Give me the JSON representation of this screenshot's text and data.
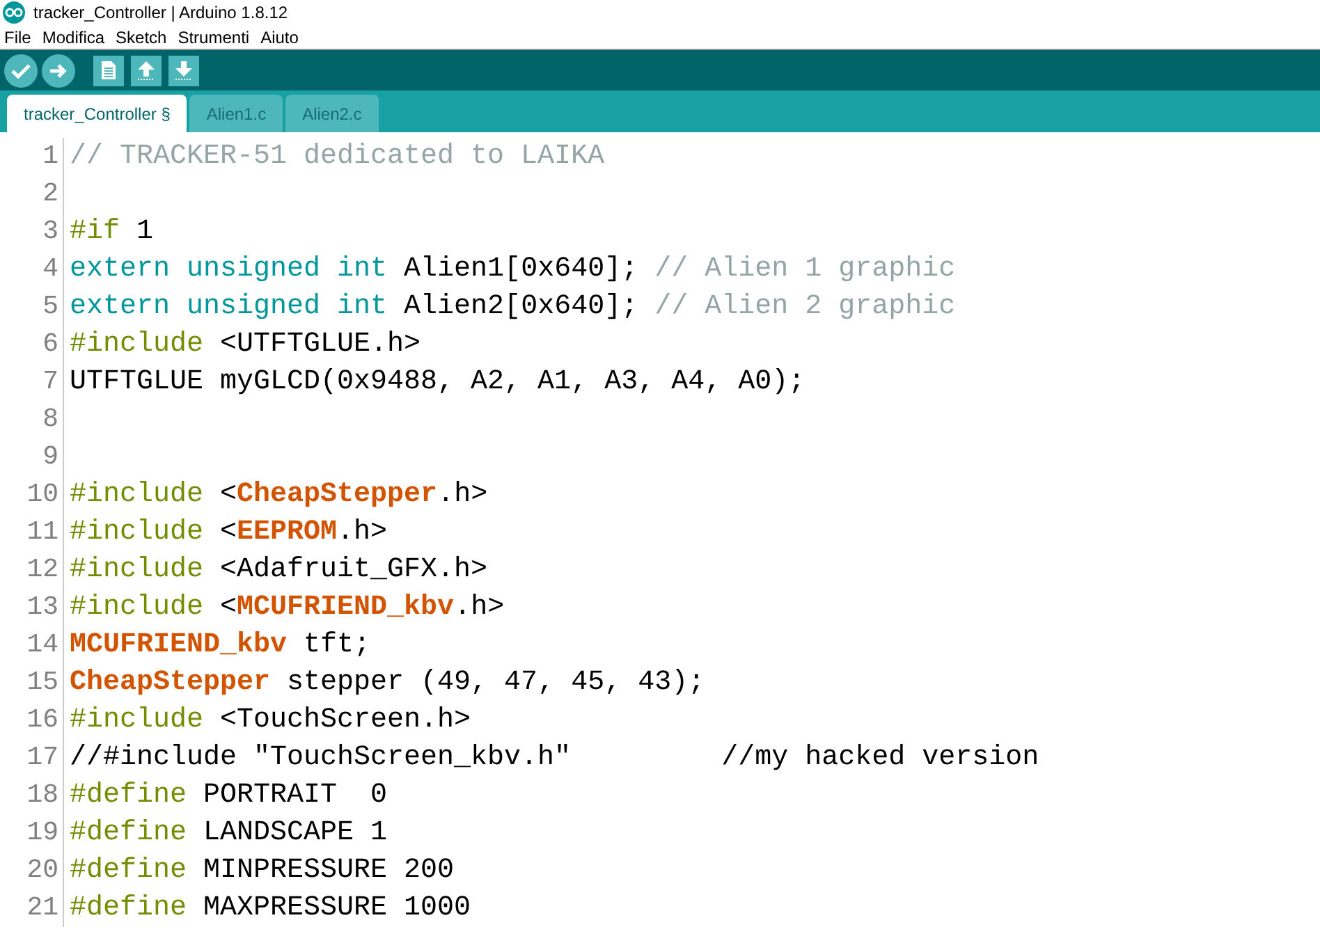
{
  "window": {
    "title": "tracker_Controller | Arduino 1.8.12"
  },
  "menu": [
    "File",
    "Modifica",
    "Sketch",
    "Strumenti",
    "Aiuto"
  ],
  "toolbar": [
    {
      "kind": "verify"
    },
    {
      "kind": "upload"
    },
    {
      "kind": "new"
    },
    {
      "kind": "open"
    },
    {
      "kind": "save"
    }
  ],
  "tabs": [
    {
      "label": "tracker_Controller §",
      "selected": true
    },
    {
      "label": "Alien1.c",
      "selected": false
    },
    {
      "label": "Alien2.c",
      "selected": false
    }
  ],
  "code": [
    {
      "number": "1",
      "tokens": [
        {
          "kind": "comment",
          "text": "// TRACKER-51 dedicated to LAIKA"
        }
      ]
    },
    {
      "number": "2"
    },
    {
      "number": "3",
      "tokens": [
        {
          "kind": "preproc",
          "text": "#if"
        },
        {
          "kind": "plain",
          "text": " 1"
        }
      ]
    },
    {
      "number": "4",
      "tokens": [
        {
          "kind": "keyword",
          "text": "extern unsigned int"
        },
        {
          "kind": "plain",
          "text": " Alien1[0x640]; "
        },
        {
          "kind": "comment",
          "text": "// Alien 1 graphic"
        }
      ]
    },
    {
      "number": "5",
      "tokens": [
        {
          "kind": "keyword",
          "text": "extern unsigned int"
        },
        {
          "kind": "plain",
          "text": " Alien2[0x640]; "
        },
        {
          "kind": "comment",
          "text": "// Alien 2 graphic"
        }
      ]
    },
    {
      "number": "6",
      "tokens": [
        {
          "kind": "preproc",
          "text": "#include"
        },
        {
          "kind": "plain",
          "text": " <UTFTGLUE.h>"
        }
      ]
    },
    {
      "number": "7",
      "tokens": [
        {
          "kind": "plain",
          "text": "UTFTGLUE myGLCD(0x9488, A2, A1, A3, A4, A0);"
        }
      ]
    },
    {
      "number": "8"
    },
    {
      "number": "9"
    },
    {
      "number": "10",
      "tokens": [
        {
          "kind": "preproc",
          "text": "#include"
        },
        {
          "kind": "plain",
          "text": " <"
        },
        {
          "kind": "lib",
          "text": "CheapStepper"
        },
        {
          "kind": "plain",
          "text": ".h>"
        }
      ]
    },
    {
      "number": "11",
      "tokens": [
        {
          "kind": "preproc",
          "text": "#include"
        },
        {
          "kind": "plain",
          "text": " <"
        },
        {
          "kind": "lib",
          "text": "EEPROM"
        },
        {
          "kind": "plain",
          "text": ".h>"
        }
      ]
    },
    {
      "number": "12",
      "tokens": [
        {
          "kind": "preproc",
          "text": "#include"
        },
        {
          "kind": "plain",
          "text": " <Adafruit_GFX.h>"
        }
      ]
    },
    {
      "number": "13",
      "tokens": [
        {
          "kind": "preproc",
          "text": "#include"
        },
        {
          "kind": "plain",
          "text": " <"
        },
        {
          "kind": "lib",
          "text": "MCUFRIEND_kbv"
        },
        {
          "kind": "plain",
          "text": ".h>"
        }
      ]
    },
    {
      "number": "14",
      "tokens": [
        {
          "kind": "lib",
          "text": "MCUFRIEND_kbv"
        },
        {
          "kind": "plain",
          "text": " tft;"
        }
      ]
    },
    {
      "number": "15",
      "tokens": [
        {
          "kind": "lib",
          "text": "CheapStepper"
        },
        {
          "kind": "plain",
          "text": " stepper (49, 47, 45, 43);"
        }
      ]
    },
    {
      "number": "16",
      "tokens": [
        {
          "kind": "preproc",
          "text": "#include"
        },
        {
          "kind": "plain",
          "text": " <TouchScreen.h>"
        }
      ]
    },
    {
      "number": "17",
      "tokens": [
        {
          "kind": "plain",
          "text": "//#include \"TouchScreen_kbv.h\"         //my hacked version"
        }
      ]
    },
    {
      "number": "18",
      "tokens": [
        {
          "kind": "preproc",
          "text": "#define"
        },
        {
          "kind": "plain",
          "text": " PORTRAIT  0"
        }
      ]
    },
    {
      "number": "19",
      "tokens": [
        {
          "kind": "preproc",
          "text": "#define"
        },
        {
          "kind": "plain",
          "text": " LANDSCAPE 1"
        }
      ]
    },
    {
      "number": "20",
      "tokens": [
        {
          "kind": "preproc",
          "text": "#define"
        },
        {
          "kind": "plain",
          "text": " MINPRESSURE 200"
        }
      ]
    },
    {
      "number": "21",
      "tokens": [
        {
          "kind": "preproc",
          "text": "#define"
        },
        {
          "kind": "plain",
          "text": " MAXPRESSURE 1000"
        }
      ]
    }
  ]
}
